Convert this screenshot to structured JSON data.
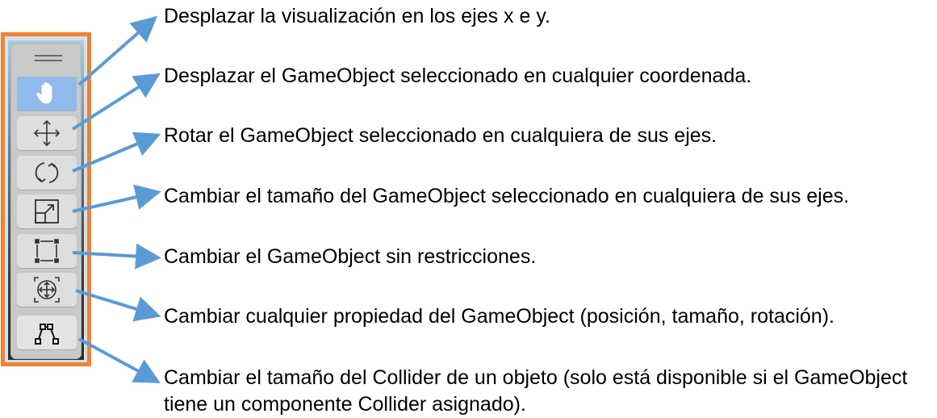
{
  "toolbar": {
    "tools": [
      {
        "icon": "hand-icon",
        "active": true
      },
      {
        "icon": "move-icon",
        "active": false
      },
      {
        "icon": "rotate-icon",
        "active": false
      },
      {
        "icon": "scale-icon",
        "active": false
      },
      {
        "icon": "rect-transform-icon",
        "active": false
      },
      {
        "icon": "transform-icon",
        "active": false
      },
      {
        "icon": "edit-collider-icon",
        "active": false
      }
    ],
    "frame_color": "#f08232",
    "active_color": "#8fbaeb"
  },
  "descriptions": [
    "Desplazar la visualización en los ejes x e y.",
    "Desplazar el GameObject seleccionado en cualquier coordenada.",
    "Rotar el GameObject seleccionado en cualquiera de sus ejes.",
    "Cambiar el tamaño del GameObject seleccionado en cualquiera de sus ejes.",
    "Cambiar el GameObject sin restricciones.",
    "Cambiar cualquier propiedad del GameObject (posición, tamaño, rotación).",
    "Cambiar el tamaño del Collider de un objeto (solo está disponible si el GameObject tiene un componente Collider asignado)."
  ],
  "arrow_color": "#5b9bd5"
}
